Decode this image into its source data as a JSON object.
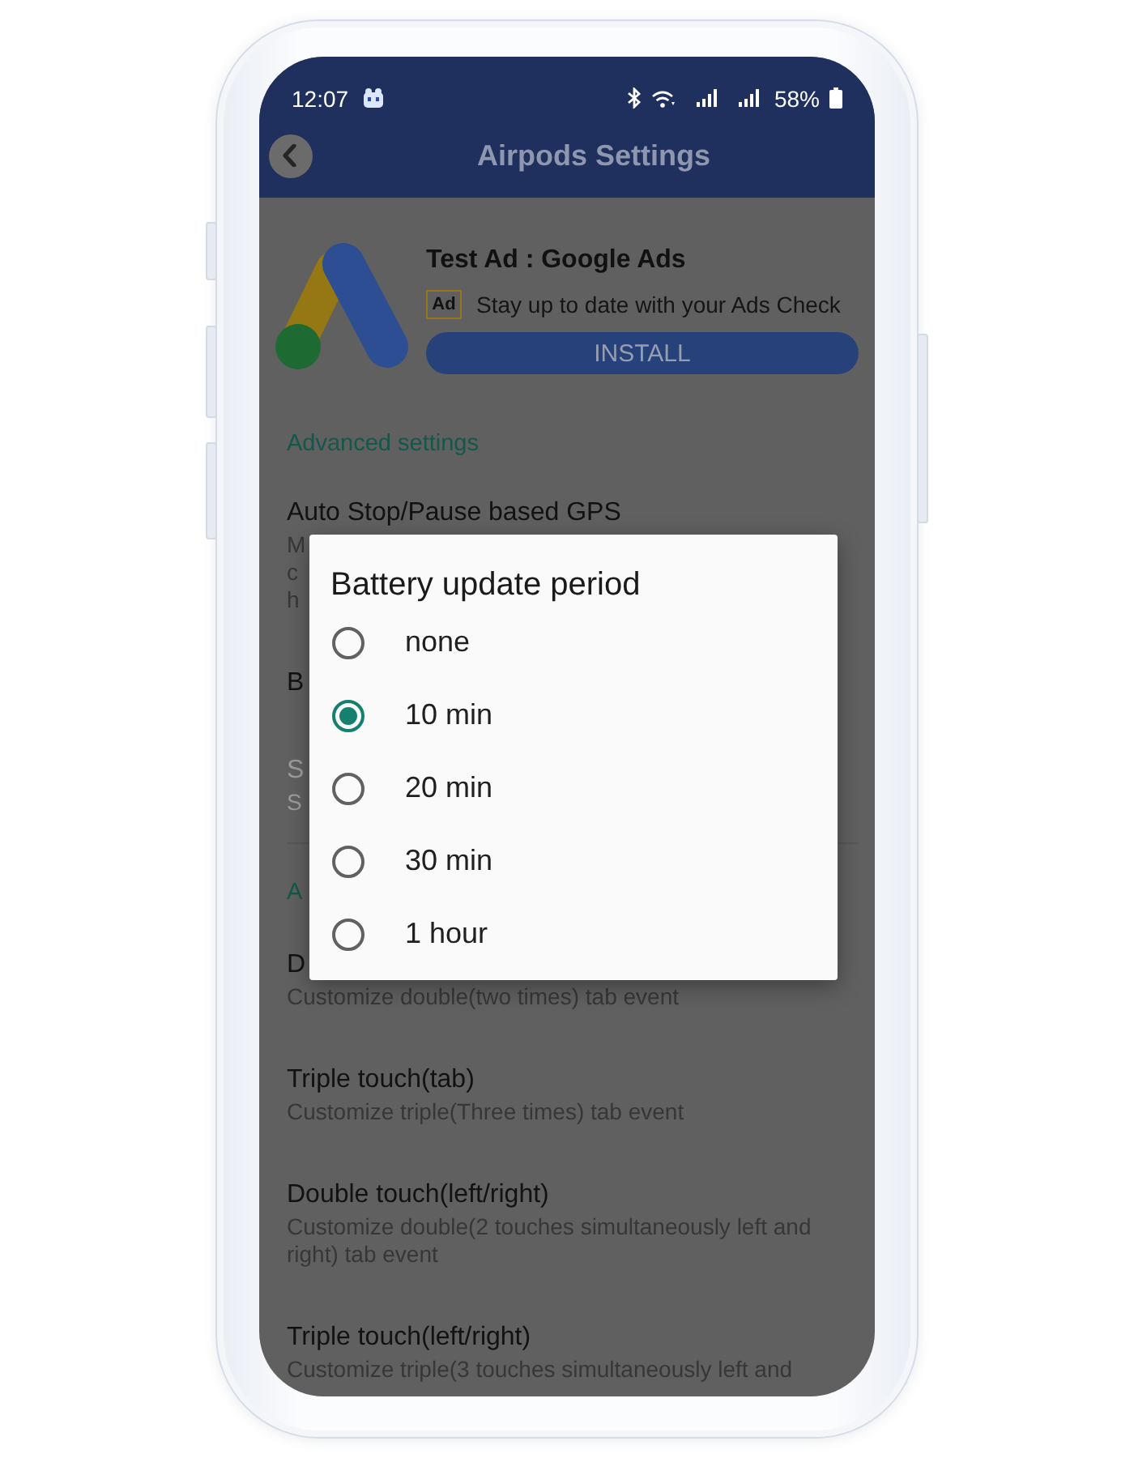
{
  "status_bar": {
    "time": "12:07",
    "battery": "58%"
  },
  "app_bar": {
    "title": "Airpods Settings"
  },
  "ad": {
    "title": "Test Ad : Google Ads",
    "badge": "Ad",
    "text": "Stay up to date with your Ads Check",
    "button": "INSTALL"
  },
  "sections": [
    {
      "header": "Advanced settings",
      "items": [
        {
          "title": "Auto Stop/Pause based GPS",
          "summary_fragments": [
            "M",
            "c",
            "h"
          ],
          "disabled": false
        },
        {
          "title": "B",
          "disabled": false
        },
        {
          "title": "S",
          "summary": "S",
          "disabled": true
        }
      ]
    },
    {
      "header": "A",
      "items": [
        {
          "title": "D",
          "summary": "Customize double(two times) tab event",
          "disabled": false
        },
        {
          "title": "Triple touch(tab)",
          "summary": "Customize triple(Three times) tab event",
          "disabled": false
        },
        {
          "title": "Double touch(left/right)",
          "summary": "Customize double(2 touches simultaneously left and right) tab event",
          "disabled": false
        },
        {
          "title": "Triple touch(left/right)",
          "summary": "Customize triple(3 touches simultaneously left and",
          "disabled": false
        }
      ]
    }
  ],
  "dialog": {
    "title": "Battery update period",
    "options": [
      {
        "label": "none",
        "selected": false
      },
      {
        "label": "10 min",
        "selected": true
      },
      {
        "label": "20 min",
        "selected": false
      },
      {
        "label": "30 min",
        "selected": false
      },
      {
        "label": "1 hour",
        "selected": false
      }
    ]
  }
}
